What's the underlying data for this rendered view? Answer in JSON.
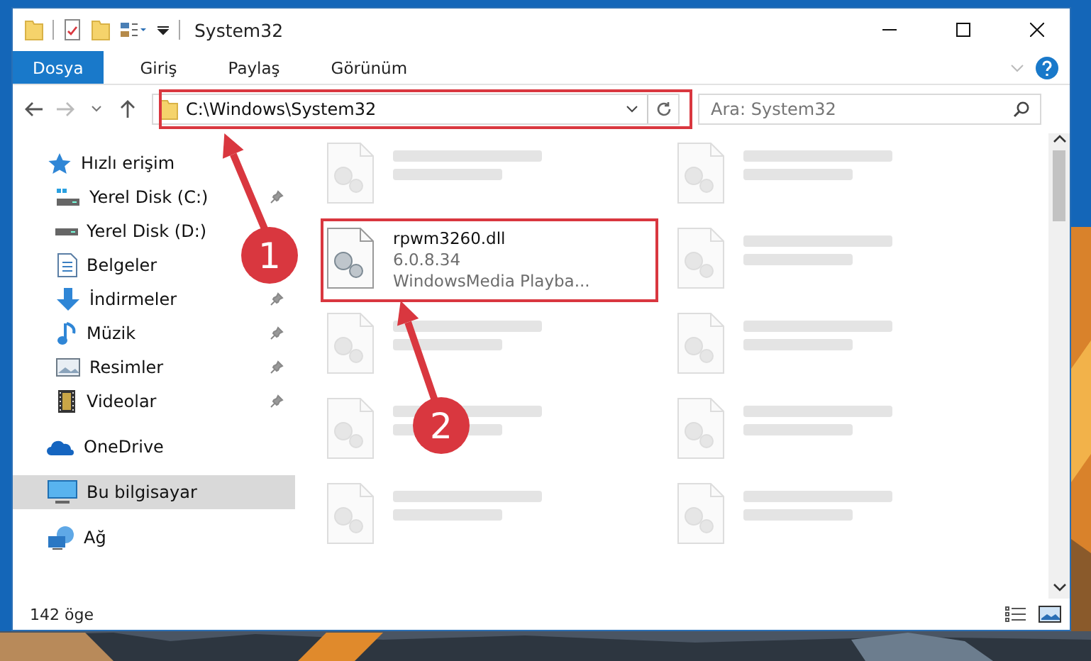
{
  "window": {
    "title": "System32"
  },
  "ribbon_tabs": [
    {
      "label": "Dosya",
      "kind": "file"
    },
    {
      "label": "Giriş",
      "kind": "tab"
    },
    {
      "label": "Paylaş",
      "kind": "tab"
    },
    {
      "label": "Görünüm",
      "kind": "tab"
    }
  ],
  "address_bar": {
    "path": "C:\\Windows\\System32"
  },
  "search": {
    "placeholder": "Ara: System32"
  },
  "sidebar": {
    "items": [
      {
        "label": "Hızlı erişim",
        "selected": false,
        "children": [
          {
            "label": "Yerel Disk (C:)",
            "pinned": true
          },
          {
            "label": "Yerel Disk (D:)",
            "pinned": false
          },
          {
            "label": "Belgeler",
            "pinned": false
          },
          {
            "label": "İndirmeler",
            "pinned": true
          },
          {
            "label": "Müzik",
            "pinned": true
          },
          {
            "label": "Resimler",
            "pinned": true
          },
          {
            "label": "Videolar",
            "pinned": true
          }
        ]
      },
      {
        "label": "OneDrive",
        "selected": false
      },
      {
        "label": "Bu bilgisayar",
        "selected": true
      },
      {
        "label": "Ağ",
        "selected": false
      }
    ]
  },
  "files": [
    {
      "kind": "blurred"
    },
    {
      "kind": "blurred"
    },
    {
      "kind": "file",
      "name": "rpwm3260.dll",
      "lines": [
        "6.0.8.34",
        "WindowsMedia Playba..."
      ],
      "highlighted": true
    },
    {
      "kind": "blurred"
    },
    {
      "kind": "blurred"
    },
    {
      "kind": "blurred"
    },
    {
      "kind": "blurred"
    },
    {
      "kind": "blurred"
    },
    {
      "kind": "blurred"
    },
    {
      "kind": "blurred"
    }
  ],
  "status_bar": {
    "count": "142 öge"
  },
  "callouts": [
    {
      "label": "1"
    },
    {
      "label": "2"
    }
  ]
}
